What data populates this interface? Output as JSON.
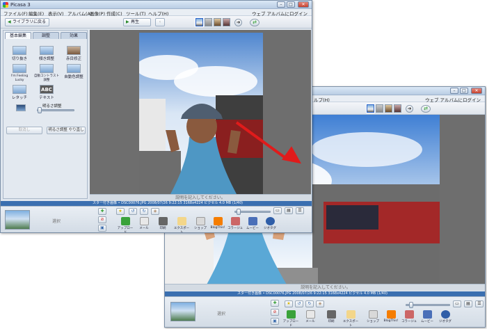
{
  "window1": {
    "title": "Picasa 3",
    "menus": [
      "ファイル(F)",
      "編集(E)",
      "表示(V)",
      "アルバム(A)",
      "画像(P)",
      "作成(C)",
      "ツール(T)",
      "ヘルプ(H)"
    ],
    "web_link": "ウェブ アルバムにログイン",
    "back_button": "ライブラリに戻る",
    "play_button": "再生",
    "tabs": [
      "基本編集",
      "調整",
      "効果"
    ],
    "tools": [
      "切り抜き",
      "傾き調整",
      "赤目修正",
      "I'm Feeling Lucky",
      "自動コントラスト調整",
      "自動色調整",
      "レタッチ",
      "テキスト"
    ],
    "slider_label": "明るさ調整",
    "undo_button": "取消し",
    "redo_button": "明るさ調整 やり直し",
    "caption_placeholder": "説明を記入してください。",
    "status_text": "スター付き画像 • DSC00076.JPG    2008/07/26 9:22:15    3168x4224 ピクセル    4.0 MB    (1/40)",
    "tray_label": "選択",
    "actions": [
      "アップロード",
      "メール",
      "印刷",
      "エクスポート",
      "ショップ",
      "BlogThis!",
      "コラージュ",
      "ムービー",
      "ジオタグ"
    ]
  },
  "window2": {
    "menu_help": "ルプ(H)",
    "web_link": "ウェブ アルバムにログイン",
    "caption_placeholder": "説明を記入してください。",
    "status_text": "スター付き画像 • DSC00076.JPG    2008/07/26 9:22:15    3168x4224 ピクセル    4.0 MB    (1/40)",
    "tray_label": "選択",
    "actions": [
      "アップロード",
      "メール",
      "印刷",
      "エクスポート",
      "ショップ",
      "BlogThis!",
      "コラージュ",
      "ムービー",
      "ジオタグ"
    ]
  },
  "colors": {
    "arrow": "#e01b1b",
    "statusbar": "#3a6fb0",
    "viewer_bg": "#6e6e6e"
  }
}
